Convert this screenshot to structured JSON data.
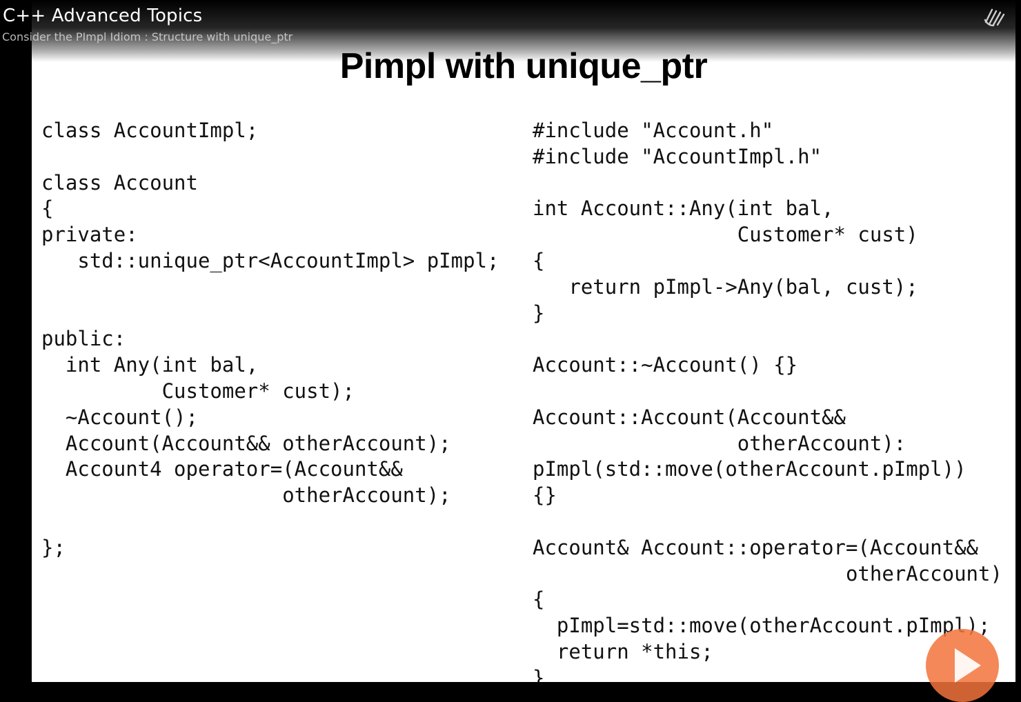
{
  "header": {
    "course_title": "C++ Advanced Topics",
    "module_title": "Consider the PImpl Idiom : Structure with unique_ptr",
    "logo_icon": "pluralsight-logo-icon"
  },
  "slide": {
    "title": "Pimpl with unique_ptr",
    "left_code": [
      "class AccountImpl;",
      "",
      "class Account",
      "{",
      "private:",
      "   std::unique_ptr<AccountImpl> pImpl;",
      "",
      "",
      "public:",
      "  int Any(int bal,",
      "          Customer* cust);",
      "  ~Account();",
      "  Account(Account&& otherAccount);",
      "  Account4 operator=(Account&&",
      "                    otherAccount);",
      "",
      "};"
    ],
    "right_code": [
      "#include \"Account.h\"",
      "#include \"AccountImpl.h\"",
      "",
      "int Account::Any(int bal,",
      "                 Customer* cust)",
      "{",
      "   return pImpl->Any(bal, cust);",
      "}",
      "",
      "Account::~Account() {}",
      "",
      "Account::Account(Account&&",
      "                 otherAccount):",
      "pImpl(std::move(otherAccount.pImpl))",
      "{}",
      "",
      "Account& Account::operator=(Account&&",
      "                          otherAccount)",
      "{",
      "  pImpl=std::move(otherAccount.pImpl);",
      "  return *this;",
      "}"
    ]
  },
  "controls": {
    "play_icon": "play-icon",
    "accent_color": "#f4743c"
  }
}
